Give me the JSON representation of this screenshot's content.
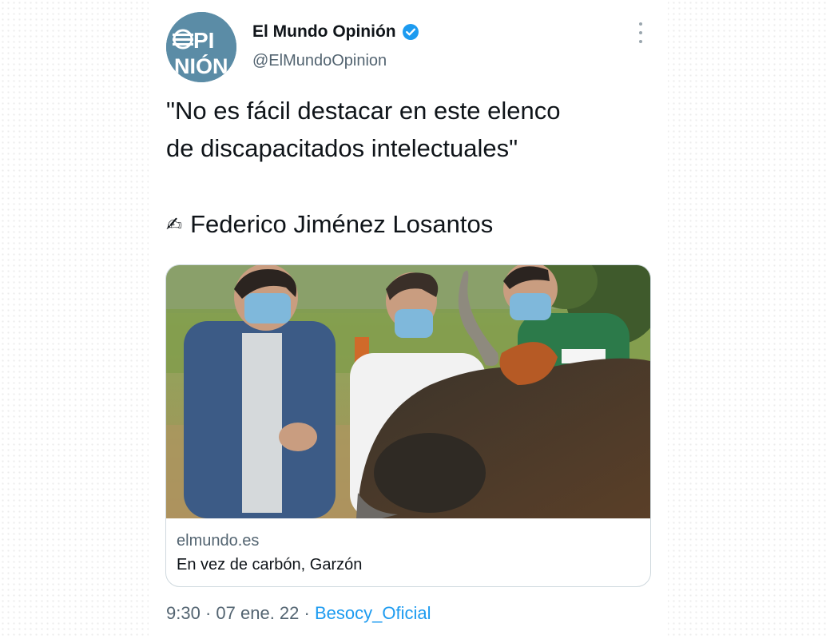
{
  "account": {
    "display_name": "El Mundo Opinión",
    "handle": "@ElMundoOpinion",
    "avatar_line1": "≡PI",
    "avatar_line2": "NIÓN",
    "verified_color": "#1d9bf0"
  },
  "tweet": {
    "text_line1": "\"No es fácil destacar en este elenco",
    "text_line2": "de discapacitados intelectuales\"",
    "author_icon": "✍",
    "author_name": "Federico Jiménez Losantos"
  },
  "link_card": {
    "image": "photo-three-masked-men-with-bull",
    "domain": "elmundo.es",
    "title": "En vez de carbón, Garzón"
  },
  "meta": {
    "time": "9:30",
    "date": "07 ene. 22",
    "via": "Besocy_Oficial"
  }
}
